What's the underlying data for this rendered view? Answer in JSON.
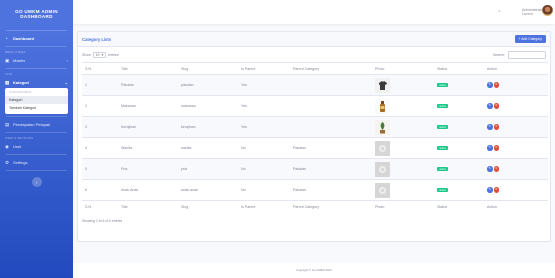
{
  "sidebar": {
    "brand": "GO UMKM ADMIN DASHBOARD",
    "dashboard_label": "Dashboard",
    "heading_menu": "Menu Utama",
    "master_label": "Master",
    "heading_kategori": "Lain",
    "kategori_label": "Kategori",
    "submenu_heading": "Kategori Menu",
    "submenu_items": [
      "Kategori",
      "Tambah Kategori"
    ],
    "pendapatan_label": "Pendapatan Pelapak",
    "heading_settings": "User & Settings",
    "user_label": "User",
    "settings_label": "Settings"
  },
  "topbar": {
    "user_name": "Administrator B. Lorem"
  },
  "card": {
    "title": "Category Lists",
    "add_button": "+ Add Category"
  },
  "controls": {
    "show_label": "Show",
    "entries_value": "10",
    "entries_label": "entries",
    "search_label": "Search:"
  },
  "table": {
    "headers": [
      "S.N.",
      "Title",
      "Slug",
      "Is Parent",
      "Parent Category",
      "Photo",
      "Status",
      "Action"
    ],
    "rows": [
      {
        "sn": "1",
        "title": "Pakaian",
        "slug": "pakaian",
        "is_parent": "Yes",
        "parent": "",
        "status": "active",
        "photo": "clothes"
      },
      {
        "sn": "2",
        "title": "Makanan",
        "slug": "makanan",
        "is_parent": "Yes",
        "parent": "",
        "status": "active",
        "photo": "bottle"
      },
      {
        "sn": "3",
        "title": "Kerajinan",
        "slug": "kerajinan",
        "is_parent": "Yes",
        "parent": "",
        "status": "active",
        "photo": "plant"
      },
      {
        "sn": "4",
        "title": "Wanita",
        "slug": "wanita",
        "is_parent": "No",
        "parent": "Pakaian",
        "status": "active",
        "photo": "placeholder"
      },
      {
        "sn": "5",
        "title": "Pria",
        "slug": "pria",
        "is_parent": "No",
        "parent": "Pakaian",
        "status": "active",
        "photo": "placeholder"
      },
      {
        "sn": "6",
        "title": "Anak Anak",
        "slug": "anak-anak",
        "is_parent": "No",
        "parent": "Pakaian",
        "status": "active",
        "photo": "placeholder"
      }
    ]
  },
  "info_text": "Showing 1 to 6 of 6 entries",
  "footer_text": "Copyright © Go UMKM 2021",
  "colors": {
    "primary": "#4e73df",
    "success": "#1cc88a",
    "danger": "#e74a3b"
  },
  "icons": {
    "dashboard": "tachometer-icon",
    "master": "folder-icon",
    "kategori": "chart-icon",
    "pendapatan": "money-icon",
    "user": "users-icon",
    "settings": "gear-icon",
    "bell": "bell-icon",
    "edit": "edit-icon",
    "delete": "trash-icon"
  }
}
